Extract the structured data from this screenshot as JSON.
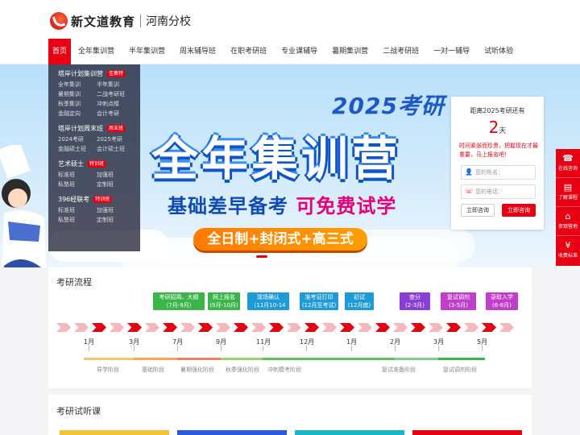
{
  "brand": {
    "name": "新文道教育",
    "campus": "河南分校"
  },
  "nav": [
    "首页",
    "全年集训营",
    "半年集训营",
    "周末辅导班",
    "在职考研班",
    "专业课辅导",
    "暑期集训营",
    "二战考研班",
    "一对一辅导",
    "试听体验"
  ],
  "menu": [
    {
      "title": "塔岸计划集训营",
      "tag": "佳集特",
      "items": [
        "全年集训",
        "半年集训",
        "暑期集训",
        "二战考研班",
        "秋季集训",
        "冲刺点睛",
        "金融定向",
        "会计考研"
      ]
    },
    {
      "title": "塔岸计划周末班",
      "tag": "周末班",
      "items": [
        "2024考研",
        "2025考研",
        "金融硕士班",
        "会计硕士班"
      ]
    },
    {
      "title": "艺术硕士",
      "tag": "特训班",
      "items": [
        "标准班",
        "加强班",
        "私塾班",
        "定制班"
      ]
    },
    {
      "title": "396经联考",
      "tag": "特训班",
      "items": [
        "标准班",
        "加强班",
        "私塾班",
        "定制班"
      ]
    }
  ],
  "banner": {
    "year": "2025考研",
    "headline": "全年集训营",
    "sub_a": "基础差早备考",
    "sub_b": "可免费试学",
    "pill": "全日制+封闭式+高三式"
  },
  "form": {
    "title": "距离2025考研还有",
    "days": "2",
    "days_unit": "天",
    "note": "时间紧张而珍贵，把握现在才最重要，马上报名吧！",
    "name_ph": "您的姓名：",
    "phone_ph": "您的电话：",
    "btn_consult": "立即咨询",
    "btn_submit": "立即咨询"
  },
  "sidebar": [
    {
      "icon": "headset-icon",
      "glyph": "☎",
      "label": "在线咨询"
    },
    {
      "icon": "course-icon",
      "glyph": "▤",
      "label": "了解课程"
    },
    {
      "icon": "campus-icon",
      "glyph": "⌂",
      "label": "参观营地"
    },
    {
      "icon": "fee-icon",
      "glyph": "¥",
      "label": "收费标准"
    }
  ],
  "process": {
    "title": "考研流程",
    "steps": [
      {
        "label": "考研招简、大纲",
        "sub": "（7月-9月）"
      },
      {
        "label": "网上报名",
        "sub": "(9月-10月)"
      },
      {
        "label": "现场确认",
        "sub": "（11月10-14日）"
      },
      {
        "label": "准考证打印",
        "sub": "(12月至考试)"
      },
      {
        "label": "初试",
        "sub": "(12月底)"
      },
      {
        "label": "查分",
        "sub": "(2-3月)"
      },
      {
        "label": "复试调剂",
        "sub": "(3-5月)"
      },
      {
        "label": "录取入学",
        "sub": "(6-8月)"
      }
    ],
    "months": [
      "1月",
      "3月",
      "7月",
      "9月",
      "11月",
      "12月",
      "1月",
      "2月",
      "3月",
      "5月"
    ],
    "phases": [
      "导学阶段",
      "基础阶段",
      "暑期强化阶段",
      "秋季强化阶段",
      "冲刺模考阶段",
      "复试准备阶段",
      "复试调剂阶段"
    ]
  },
  "trial": {
    "title": "考研试听课"
  },
  "colors": {
    "brand": "#e60012",
    "step_green": "#3bb54a",
    "step_blue": "#1e9bd7",
    "step_purple": "#8a3fd4"
  }
}
